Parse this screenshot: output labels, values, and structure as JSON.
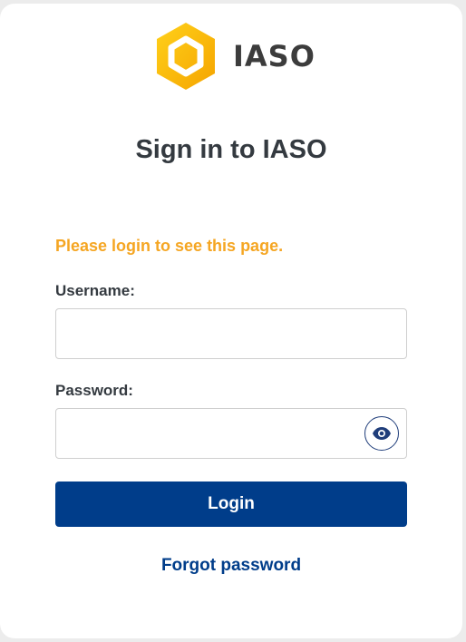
{
  "brand": {
    "name": "IASO",
    "logo_icon": "hexagon-logo-icon",
    "logo_color": "#f5b400"
  },
  "title": "Sign in to IASO",
  "alert": {
    "message": "Please login to see this page.",
    "color": "#f5a623"
  },
  "form": {
    "username_label": "Username:",
    "username_value": "",
    "password_label": "Password:",
    "password_value": "",
    "show_password_icon": "eye-icon",
    "login_label": "Login",
    "forgot_label": "Forgot password"
  },
  "colors": {
    "primary": "#003d8a",
    "text": "#343a40",
    "background": "#ececec"
  }
}
